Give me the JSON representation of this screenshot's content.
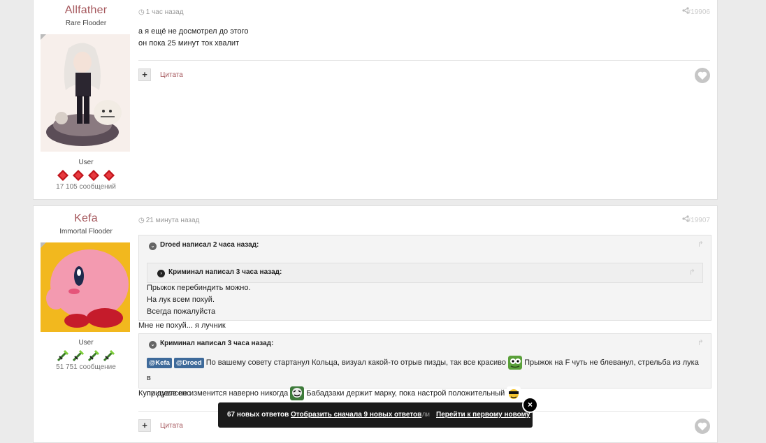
{
  "posts": [
    {
      "author": {
        "name": "Allfather",
        "rank": "Rare Flooder",
        "group": "User",
        "post_count": "17 105 сообщений",
        "badge_icon": "red-diamond-rank-icon"
      },
      "time": "1 час назад",
      "post_number": "#19906",
      "lines": [
        "а я ещё не досмотрел до этого",
        "он пока 25 минут ток хвалит"
      ],
      "quote_label": "Цитата"
    },
    {
      "author": {
        "name": "Kefa",
        "rank": "Immortal Flooder",
        "group": "User",
        "post_count": "51 751 сообщение",
        "badge_icon": "green-sword-rank-icon"
      },
      "time": "21 минута назад",
      "post_number": "#19907",
      "quote1": {
        "header": "Droed написал 2 часа назад:",
        "nested": {
          "header": "Криминал написал 3 часа назад:"
        },
        "lines": [
          "Прыжок перебиндить можно.",
          "На лук всем похуй.",
          "Всегда пожалуйста"
        ]
      },
      "reply1": "Мне не похуй... я лучник",
      "quote2": {
        "header": "Криминал написал 3 часа назад:",
        "mention1": "@Kefa",
        "mention2": "@Droed",
        "text1": "По вашему совету стартанул Кольца, визуал какой-то отрыв пизды, так все красиво",
        "text2": "Прыжок на F чуть не блеванул, стрельба из лука в",
        "text3": "прицеле не изменится наверно никогда",
        "text4": "Бабадзаки держит марку, пока настрой положительный"
      },
      "reply2": "Купи дуалсенс",
      "quote_label": "Цитата"
    }
  ],
  "toast": {
    "new_replies": "67 новых ответов",
    "show_first": "Отобразить сначала 9 новых ответов",
    "or": "или",
    "goto_first": "Перейти к первому новому",
    "close": "×"
  },
  "colors": {
    "author_name": "#a5575c",
    "mention_bg": "#3e6a9a",
    "toast_bg": "#1b1b1b"
  }
}
